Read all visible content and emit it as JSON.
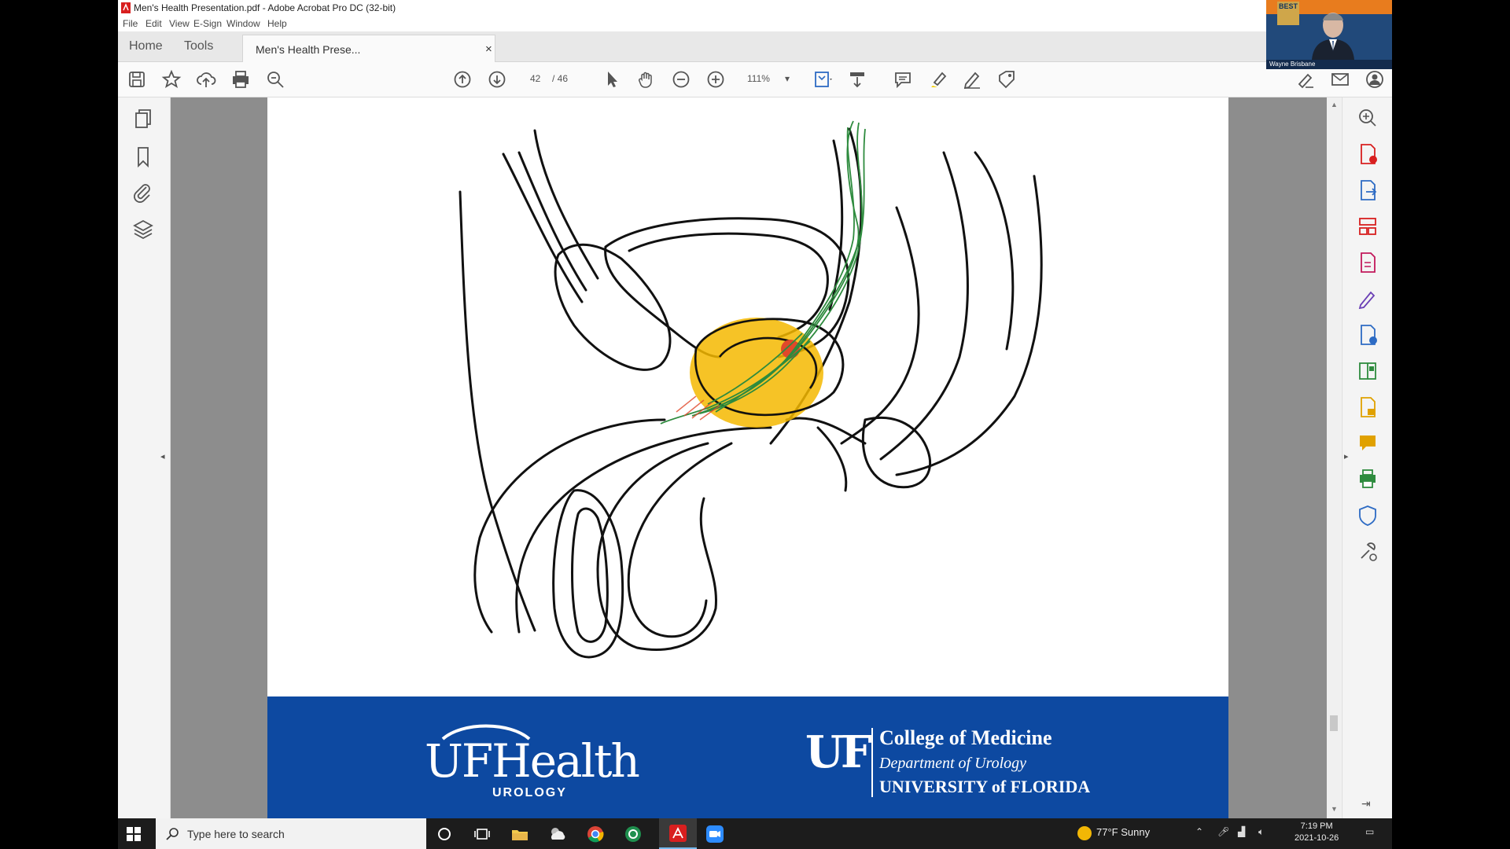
{
  "window": {
    "title": "Men's Health Presentation.pdf - Adobe Acrobat Pro DC (32-bit)"
  },
  "menu": [
    "File",
    "Edit",
    "View",
    "E-Sign",
    "Window",
    "Help"
  ],
  "tabs": {
    "home": "Home",
    "tools": "Tools",
    "document": "Men's Health Prese...",
    "close": "×"
  },
  "toolbar": {
    "current_page": "42",
    "total_pages": "/ 46",
    "zoom": "111%"
  },
  "banner": {
    "ufhealth": "UFHealth",
    "urology": "UROLOGY",
    "uf": "UF",
    "college": "College of Medicine",
    "department": "Department of Urology",
    "university": "UNIVERSITY of FLORIDA"
  },
  "webcam": {
    "name": "Wayne Brisbane",
    "badge": "BEST"
  },
  "taskbar": {
    "search_placeholder": "Type here to search",
    "weather": "77°F  Sunny",
    "time": "7:19 PM",
    "date": "2021-10-26"
  },
  "colors": {
    "acrobat_red": "#d81f1f",
    "banner_blue": "#0d49a1",
    "highlight": "#f5b800",
    "nerve_green": "#2e8b3e"
  }
}
